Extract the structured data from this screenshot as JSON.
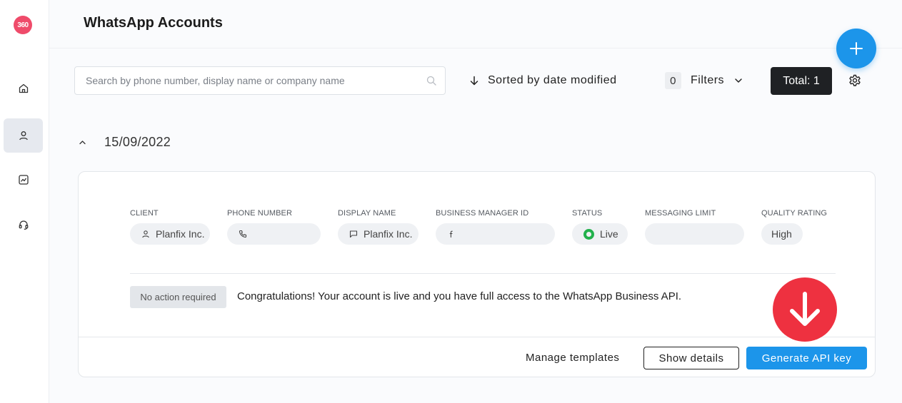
{
  "app": {
    "logo_text": "360"
  },
  "sidebar": {
    "items": [
      {
        "name": "home",
        "icon": "home-icon",
        "active": false
      },
      {
        "name": "accounts",
        "icon": "user-icon",
        "active": true
      },
      {
        "name": "analytics",
        "icon": "chart-icon",
        "active": false
      },
      {
        "name": "support",
        "icon": "headset-icon",
        "active": false
      }
    ]
  },
  "header": {
    "title": "WhatsApp Accounts"
  },
  "toolbar": {
    "search_placeholder": "Search by phone number, display name or company name",
    "search_value": "",
    "sort_label": "Sorted by date modified",
    "filters_count": "0",
    "filters_label": "Filters",
    "total_label": "Total: 1"
  },
  "group": {
    "date": "15/09/2022",
    "expanded": true
  },
  "account": {
    "client_label": "CLIENT",
    "client_value": "Planfix Inc.",
    "phone_label": "PHONE NUMBER",
    "phone_value": "",
    "display_label": "DISPLAY NAME",
    "display_value": "Planfix Inc.",
    "bm_label": "BUSINESS MANAGER ID",
    "bm_value": "",
    "status_label": "STATUS",
    "status_value": "Live",
    "limit_label": "MESSAGING LIMIT",
    "limit_value": "",
    "quality_label": "QUALITY RATING",
    "quality_value": "High",
    "action_badge": "No action required",
    "message": "Congratulations! Your account is live and you have full access to the WhatsApp Business API.",
    "manage_templates": "Manage templates",
    "show_details": "Show details",
    "generate_api_key": "Generate API key"
  },
  "colors": {
    "accent": "#1c95ea",
    "brand": "#ef4b6a",
    "status_live": "#22b14c",
    "overlay": "#ee3140",
    "total_bg": "#1f2124"
  }
}
